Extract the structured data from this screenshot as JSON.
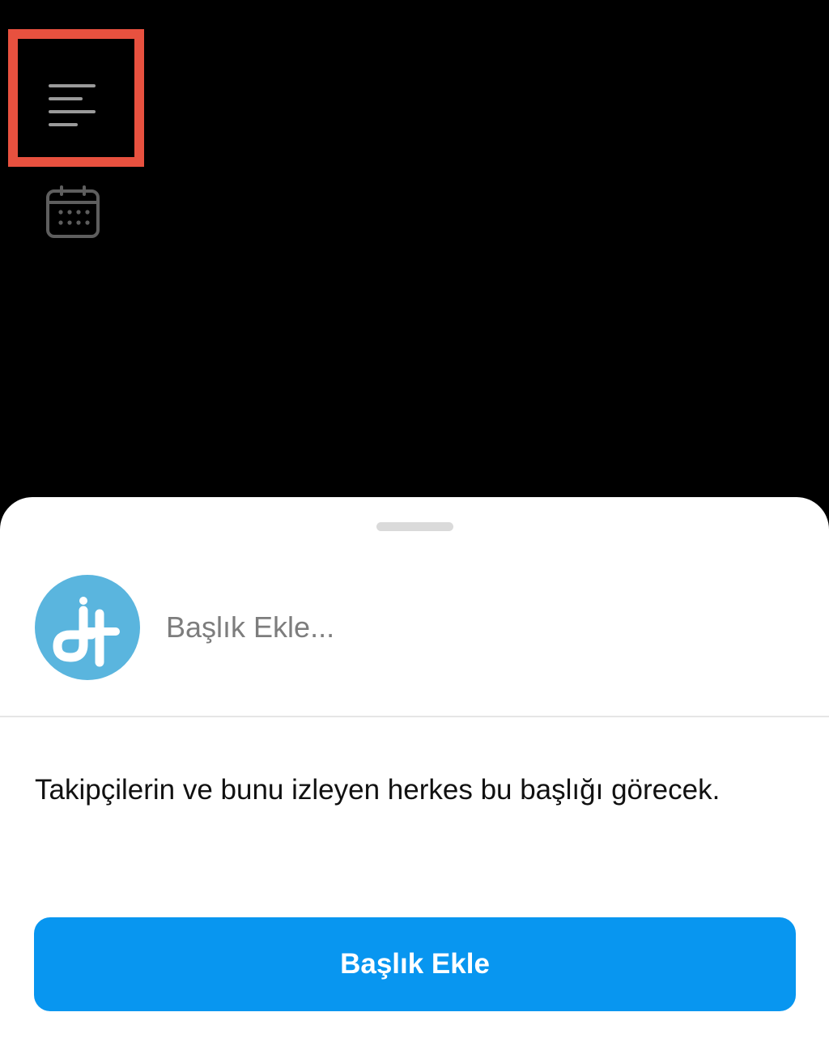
{
  "highlight": {
    "color": "#e8513f"
  },
  "icons": {
    "title_tool": "text-align-left-icon",
    "calendar_tool": "calendar-icon"
  },
  "sheet": {
    "avatar": {
      "icon": "profile-logo-icon",
      "color": "#5ab5de"
    },
    "title_input": {
      "placeholder": "Başlık Ekle...",
      "value": ""
    },
    "info_text": "Takipçilerin ve bunu izleyen herkes bu başlığı görecek.",
    "add_button": {
      "label": "Başlık Ekle",
      "color": "#0896f0"
    }
  }
}
